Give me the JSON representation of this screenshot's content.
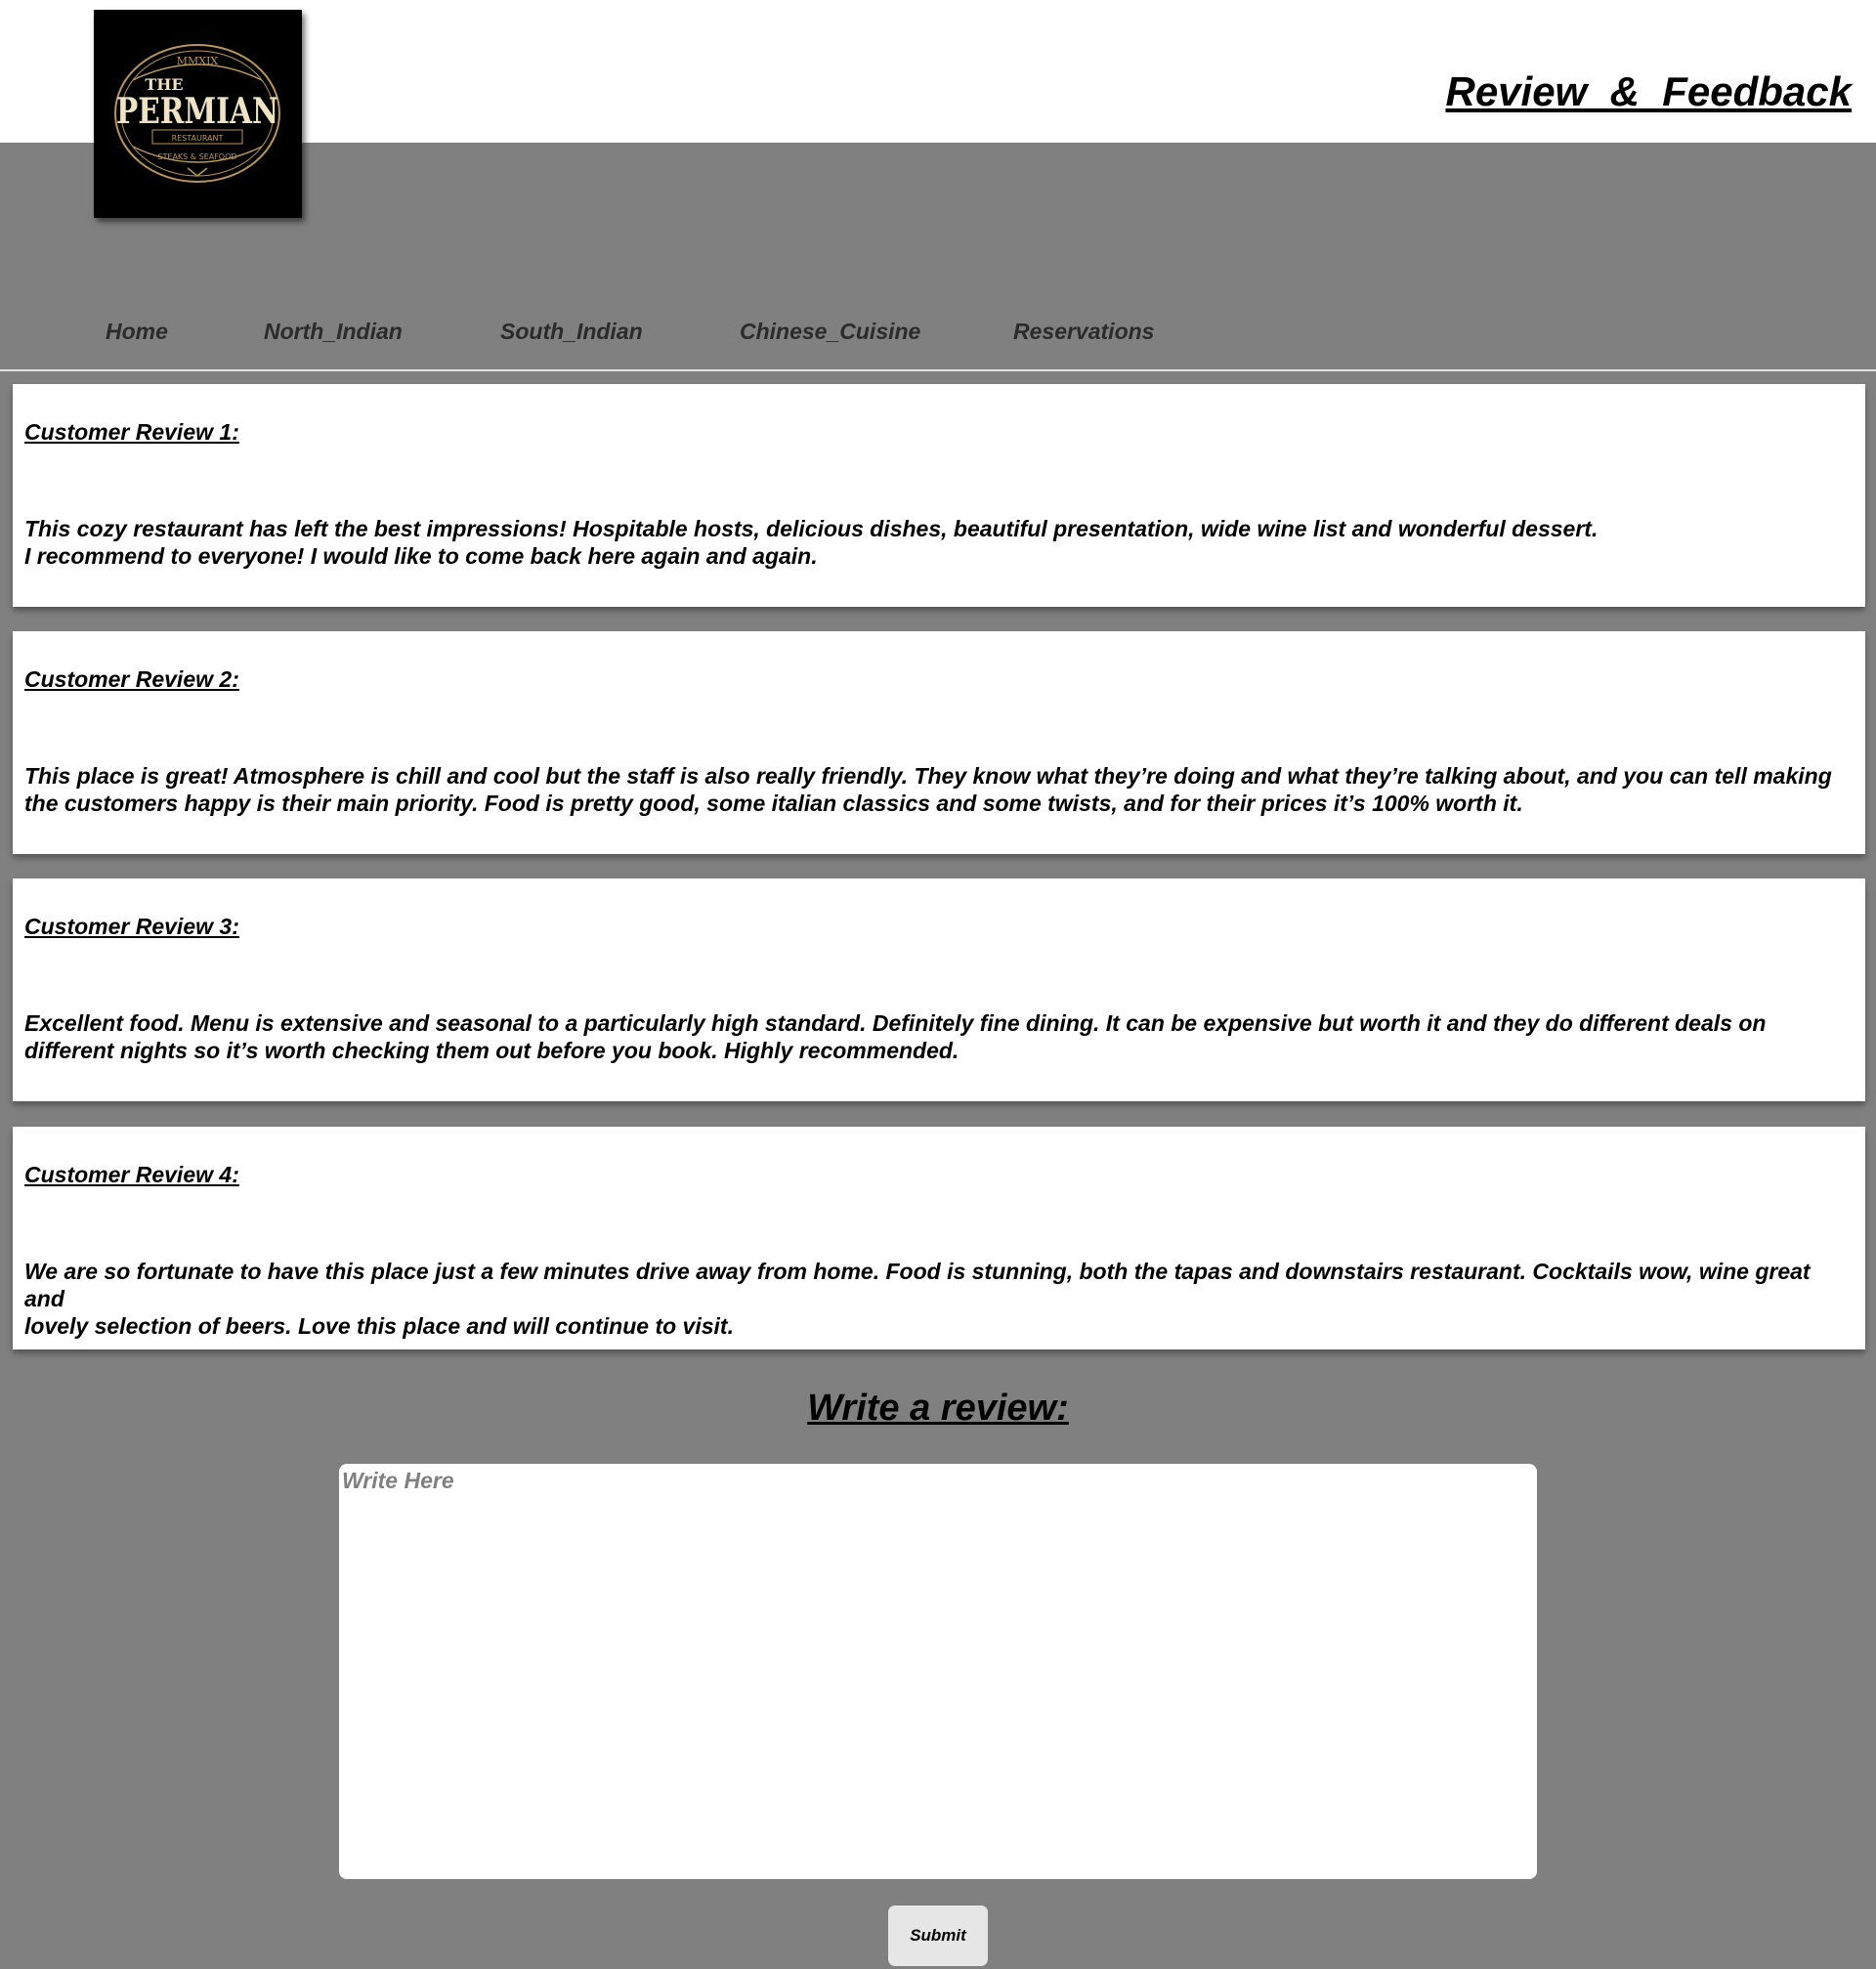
{
  "header": {
    "title": "Review  &  Feedback",
    "logo": {
      "icon": "the-permian-restaurant-logo",
      "year_text": "MMXIX",
      "line1": "THE",
      "line2": "PERMIAN",
      "line3": "RESTAURANT",
      "line4": "STEAKS & SEAFOOD"
    }
  },
  "nav": {
    "items": [
      {
        "label": "Home"
      },
      {
        "label": "North_Indian"
      },
      {
        "label": "South_Indian"
      },
      {
        "label": "Chinese_Cuisine"
      },
      {
        "label": "Reservations"
      }
    ]
  },
  "reviews": [
    {
      "heading": "Customer Review 1:",
      "lines": [
        "This cozy restaurant has left the best impressions! Hospitable hosts, delicious dishes, beautiful presentation, wide wine list and wonderful dessert.",
        "I recommend to everyone! I would like to come back here again and again."
      ]
    },
    {
      "heading": "Customer Review 2:",
      "lines": [
        "This place is great! Atmosphere is chill and cool but the staff is also really friendly. They know what they’re doing and what they’re talking about, and you can tell making",
        "the customers happy is their main priority. Food is pretty good, some italian classics and some twists, and for their prices it’s 100% worth it."
      ]
    },
    {
      "heading": "Customer Review 3:",
      "lines": [
        "Excellent food. Menu is extensive and seasonal to a particularly high standard. Definitely fine dining. It can be expensive but worth it and they do different deals on",
        "different nights so it’s worth checking them out before you book. Highly recommended."
      ]
    },
    {
      "heading": "Customer Review 4:",
      "lines": [
        "We are so fortunate to have this place just a few minutes drive away from home. Food is stunning, both the tapas and downstairs restaurant. Cocktails wow, wine great and",
        "lovely selection of beers. Love this place and will continue to visit."
      ]
    }
  ],
  "write_review": {
    "title": "Write a review:",
    "placeholder": "Write Here",
    "value": "",
    "submit_label": "Submit"
  },
  "colors": {
    "page_background": "#808080",
    "header_background": "#ffffff",
    "card_background": "#ffffff",
    "logo_background": "#000000",
    "logo_gold": "#b8955a",
    "logo_cream": "#efe3c4",
    "button_background": "#e6e6e6"
  }
}
